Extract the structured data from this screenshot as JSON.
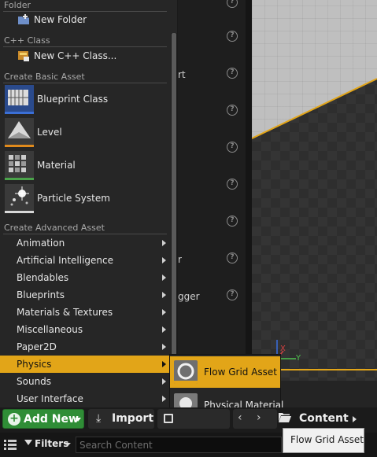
{
  "background": {
    "fragments": [
      "rt",
      "r",
      "gger"
    ]
  },
  "menu": {
    "sections": {
      "folder": "Folder",
      "cpp": "C++ Class",
      "basic": "Create Basic Asset",
      "advanced": "Create Advanced Asset"
    },
    "folder_item": "New Folder",
    "cpp_item": "New C++ Class...",
    "basic_assets": [
      {
        "label": "Blueprint Class",
        "accent": "#3b6fd6"
      },
      {
        "label": "Level",
        "accent": "#e08a1c"
      },
      {
        "label": "Material",
        "accent": "#4aa34a"
      },
      {
        "label": "Particle System",
        "accent": "#d8d8d8"
      }
    ],
    "advanced_items": [
      "Animation",
      "Artificial Intelligence",
      "Blendables",
      "Blueprints",
      "Materials & Textures",
      "Miscellaneous",
      "Paper2D",
      "Physics",
      "Sounds",
      "User Interface"
    ],
    "highlight_color": "#e2a518"
  },
  "submenu": {
    "items": [
      {
        "label": "Flow Grid Asset"
      },
      {
        "label": "Physical Material"
      }
    ]
  },
  "viewport": {
    "axis_x": "X",
    "axis_y": "Y"
  },
  "toolbar": {
    "add_new": "Add New",
    "import": "Import",
    "path": "Content"
  },
  "filter_bar": {
    "filters": "Filters",
    "search_placeholder": "Search Content"
  },
  "tooltip": "Flow Grid Asset"
}
